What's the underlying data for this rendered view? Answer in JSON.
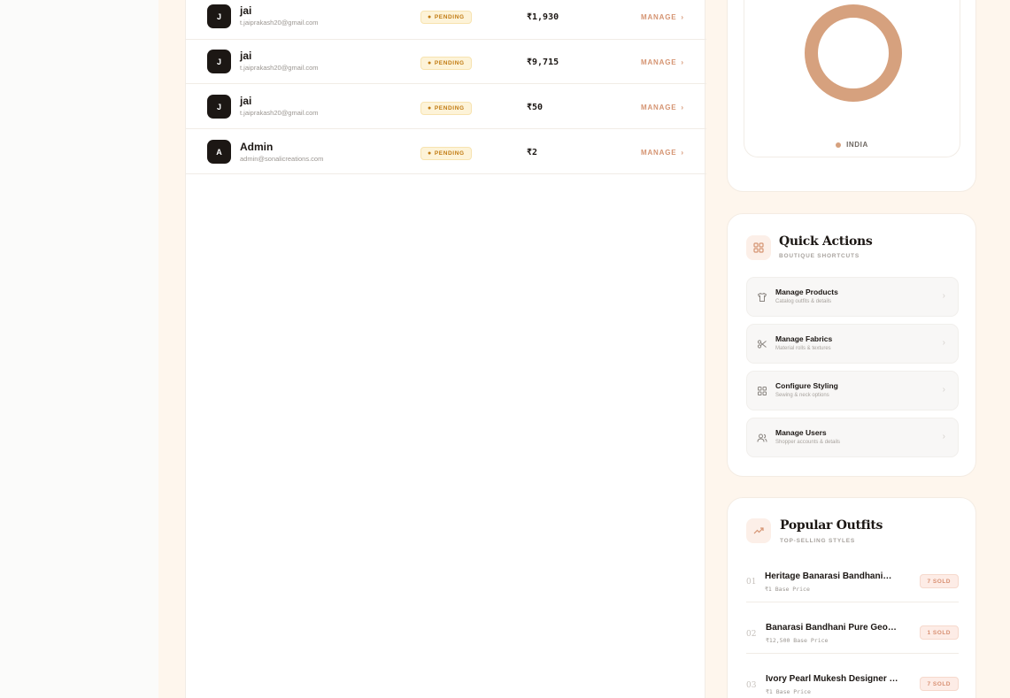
{
  "orders": [
    {
      "initial": "J",
      "name": "jai",
      "email": "t.jaiprakash20@gmail.com",
      "status": "PENDING",
      "amount": "₹1,930",
      "action": "MANAGE"
    },
    {
      "initial": "J",
      "name": "jai",
      "email": "t.jaiprakash20@gmail.com",
      "status": "PENDING",
      "amount": "₹9,715",
      "action": "MANAGE"
    },
    {
      "initial": "J",
      "name": "jai",
      "email": "t.jaiprakash20@gmail.com",
      "status": "PENDING",
      "amount": "₹50",
      "action": "MANAGE"
    },
    {
      "initial": "A",
      "name": "Admin",
      "email": "admin@sonalicreations.com",
      "status": "PENDING",
      "amount": "₹2",
      "action": "MANAGE"
    }
  ],
  "geo": {
    "legend": "INDIA",
    "color": "#d6a17e"
  },
  "quick_actions": {
    "title": "Quick Actions",
    "subtitle": "BOUTIQUE SHORTCUTS",
    "icon": "grid-icon",
    "items": [
      {
        "label": "Manage Products",
        "sub": "Catalog outfits & details",
        "icon": "shirt-icon"
      },
      {
        "label": "Manage Fabrics",
        "sub": "Material rolls & textures",
        "icon": "scissors-icon"
      },
      {
        "label": "Configure Styling",
        "sub": "Sewing & neck options",
        "icon": "grid-icon"
      },
      {
        "label": "Manage Users",
        "sub": "Shopper accounts & details",
        "icon": "users-icon"
      }
    ]
  },
  "popular": {
    "title": "Popular Outfits",
    "subtitle": "TOP-SELLING STYLES",
    "icon": "trending-up-icon",
    "items": [
      {
        "rank": "01",
        "name": "Heritage Banarasi Bandhani…",
        "price": "₹1 Base Price",
        "sold": "7 SOLD"
      },
      {
        "rank": "02",
        "name": "Banarasi Bandhani Pure Georgett…",
        "price": "₹12,500 Base Price",
        "sold": "1 SOLD"
      },
      {
        "rank": "03",
        "name": "Ivory Pearl Mukesh Designer Sar…",
        "price": "₹1 Base Price",
        "sold": "7 SOLD"
      }
    ]
  },
  "colors": {
    "accent": "#d59472",
    "dark": "#1c1714",
    "pending_text": "#c17b12",
    "pending_bg": "#fdf3d8"
  }
}
